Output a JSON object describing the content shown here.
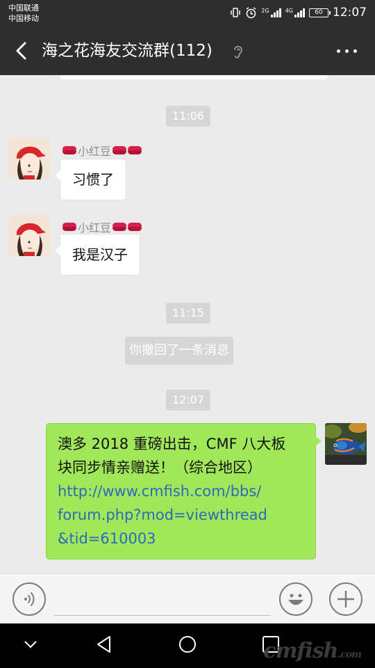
{
  "status_bar": {
    "carrier_1": "中国联通",
    "carrier_2": "中国移动",
    "network_1": "2G",
    "network_2": "4G",
    "battery": "60",
    "time": "12:07",
    "icons": [
      "vibrate-icon",
      "alarm-icon",
      "signal-icon",
      "battery-icon"
    ]
  },
  "header": {
    "title": "海之花海友交流群(112)",
    "icons": [
      "back-arrow-icon",
      "ear-icon",
      "more-icon"
    ]
  },
  "chat": {
    "messages": [
      {
        "type": "time",
        "text": "11:06"
      },
      {
        "type": "incoming",
        "sender": "小红豆",
        "text": "习惯了"
      },
      {
        "type": "incoming",
        "sender": "小红豆",
        "text": "我是汉子"
      },
      {
        "type": "time",
        "text": "11:15"
      },
      {
        "type": "system",
        "text": "你撤回了一条消息"
      },
      {
        "type": "time",
        "text": "12:07"
      },
      {
        "type": "outgoing",
        "text_line1": "澳多 2018 重磅出击，CMF 八大板",
        "text_line2": "块同步情亲赠送！（综合地区）",
        "link_line1": "http://www.cmfish.com/bbs/",
        "link_line2": "forum.php?mod=viewthread",
        "link_line3": "&tid=610003"
      }
    ]
  },
  "input_bar": {
    "icons": [
      "voice-icon",
      "emoji-icon",
      "plus-icon"
    ]
  },
  "nav_bar": {
    "icons": [
      "collapse-chevron-icon",
      "back-triangle-icon",
      "home-circle-icon",
      "recents-square-icon"
    ],
    "watermark_main": "cmfish",
    "watermark_suffix": ".com"
  },
  "colors": {
    "header_bg": "#2e2e2e",
    "chat_bg": "#ebebeb",
    "outgoing_bubble": "#a0e75a",
    "link": "#2b6ab8"
  }
}
